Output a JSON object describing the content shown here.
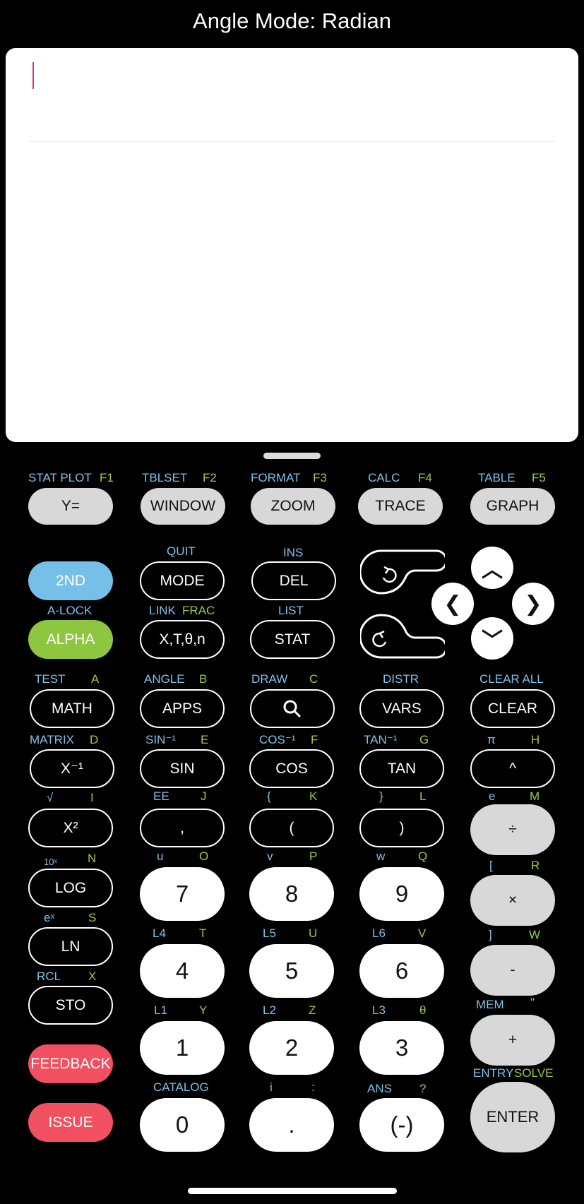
{
  "title": "Angle Mode: Radian",
  "keys": {
    "y_eq": "Y=",
    "window": "WINDOW",
    "zoom": "ZOOM",
    "trace": "TRACE",
    "graph": "GRAPH",
    "second": "2ND",
    "mode": "MODE",
    "del": "DEL",
    "alpha": "ALPHA",
    "xtn": "X,T,θ,n",
    "stat": "STAT",
    "math": "MATH",
    "apps": "APPS",
    "vars": "VARS",
    "clear": "CLEAR",
    "xinv": "X⁻¹",
    "sin": "SIN",
    "cos": "COS",
    "tan": "TAN",
    "pow": "^",
    "xsq": "X²",
    "comma": ",",
    "lparen": "(",
    "rparen": ")",
    "div": "÷",
    "log": "LOG",
    "seven": "7",
    "eight": "8",
    "nine": "9",
    "mul": "×",
    "ln": "LN",
    "four": "4",
    "five": "5",
    "six": "6",
    "sub": "-",
    "sto": "STO",
    "one": "1",
    "two": "2",
    "three": "3",
    "add": "+",
    "feedback": "FEEDBACK",
    "issue": "ISSUE",
    "zero": "0",
    "dot": ".",
    "neg": "(-)",
    "enter": "ENTER"
  },
  "labels": {
    "stat_plot": "STAT PLOT",
    "f1": "F1",
    "tblset": "TBLSET",
    "f2": "F2",
    "format": "FORMAT",
    "f3": "F3",
    "calc": "CALC",
    "f4": "F4",
    "table": "TABLE",
    "f5": "F5",
    "quit": "QUIT",
    "ins": "INS",
    "a_lock": "A-LOCK",
    "link": "LINK",
    "frac": "FRAC",
    "list": "LIST",
    "test": "TEST",
    "a": "A",
    "angle": "ANGLE",
    "b": "B",
    "draw": "DRAW",
    "c": "C",
    "distr": "DISTR",
    "clear_all": "CLEAR ALL",
    "matrix": "MATRIX",
    "d": "D",
    "sin_inv": "SIN⁻¹",
    "e": "E",
    "cos_inv": "COS⁻¹",
    "f": "F",
    "tan_inv": "TAN⁻¹",
    "g": "G",
    "pi": "π",
    "h": "H",
    "sqrt": "√",
    "i": "I",
    "ee": "EE",
    "j": "J",
    "lbrace": "{",
    "k": "K",
    "rbrace": "}",
    "l": "L",
    "e_const": "e",
    "m": "M",
    "ten_x": "10ˣ",
    "n": "N",
    "u": "u",
    "o": "O",
    "v": "v",
    "p": "P",
    "w": "w",
    "q": "Q",
    "lbracket": "[",
    "r": "R",
    "e_x": "eˣ",
    "s": "S",
    "l4": "L4",
    "t": "T",
    "l5": "L5",
    "u_up": "U",
    "l6": "L6",
    "v_up": "V",
    "rbracket": "]",
    "w_up": "W",
    "rcl": "RCL",
    "x": "X",
    "l1": "L1",
    "y": "Y",
    "l2": "L2",
    "z": "Z",
    "l3": "L3",
    "theta": "θ",
    "mem": "MEM",
    "quote": "\"",
    "catalog": "CATALOG",
    "imag": "i",
    "colon": ":",
    "ans": "ANS",
    "question": "?",
    "entry": "ENTRY",
    "solve": "SOLVE"
  },
  "icons": {
    "up": "chevron-up",
    "down": "chevron-down",
    "left": "chevron-left",
    "right": "chevron-right",
    "search": "magnifier",
    "undo": "undo",
    "redo": "redo"
  }
}
